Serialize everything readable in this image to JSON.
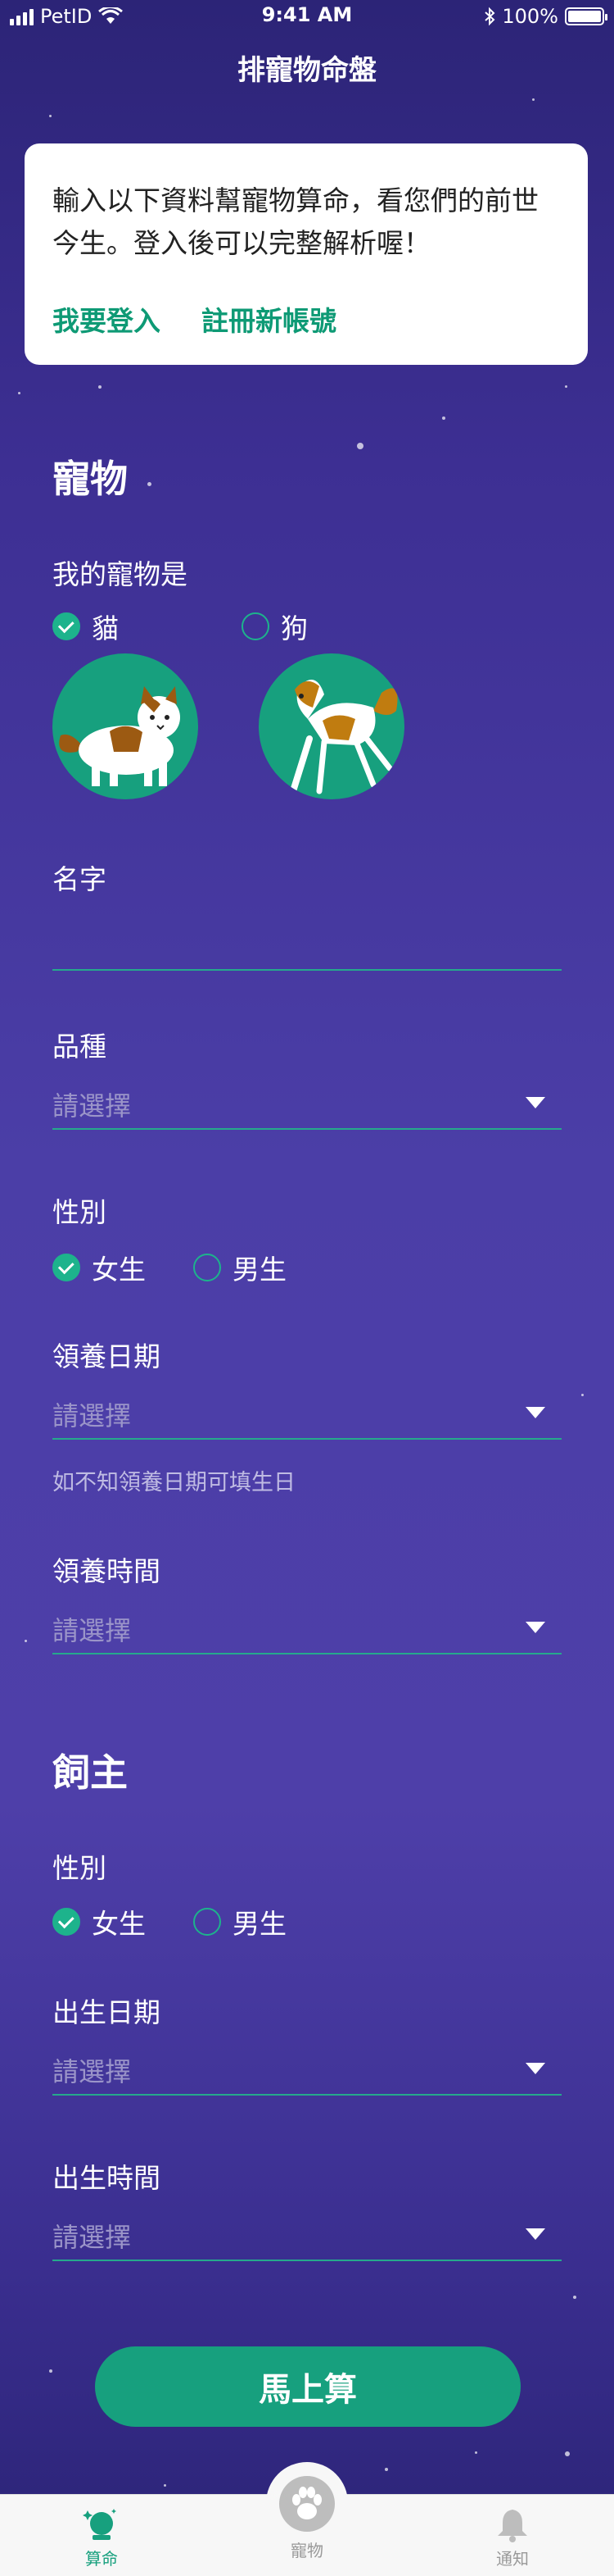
{
  "status_bar": {
    "carrier": "PetID",
    "time": "9:41 AM",
    "battery": "100%"
  },
  "nav": {
    "title": "排寵物命盤"
  },
  "login_card": {
    "message": "輸入以下資料幫寵物算命，看您們的前世今生。登入後可以完整解析喔！",
    "login_link": "我要登入",
    "register_link": "註冊新帳號"
  },
  "pet_section": {
    "title": "寵物",
    "type_label": "我的寵物是",
    "type_options": [
      {
        "label": "貓",
        "checked": true
      },
      {
        "label": "狗",
        "checked": false
      }
    ],
    "name_label": "名字",
    "name_value": "",
    "breed_label": "品種",
    "breed_placeholder": "請選擇",
    "gender_label": "性別",
    "gender_options": [
      {
        "label": "女生",
        "checked": true
      },
      {
        "label": "男生",
        "checked": false
      }
    ],
    "adopt_date_label": "領養日期",
    "adopt_date_placeholder": "請選擇",
    "adopt_date_hint": "如不知領養日期可填生日",
    "adopt_time_label": "領養時間",
    "adopt_time_placeholder": "請選擇"
  },
  "owner_section": {
    "title": "飼主",
    "gender_label": "性別",
    "gender_options": [
      {
        "label": "女生",
        "checked": true
      },
      {
        "label": "男生",
        "checked": false
      }
    ],
    "birth_date_label": "出生日期",
    "birth_date_placeholder": "請選擇",
    "birth_time_label": "出生時間",
    "birth_time_placeholder": "請選擇"
  },
  "submit_label": "馬上算",
  "tabbar": {
    "items": [
      {
        "label": "算命",
        "icon": "fortune-crystal-icon",
        "active": true
      },
      {
        "label": "寵物",
        "icon": "paw-icon",
        "active": false
      },
      {
        "label": "通知",
        "icon": "bell-icon",
        "active": false
      }
    ]
  },
  "colors": {
    "accent": "#17a07e",
    "background_top": "#2c2477",
    "background_mid": "#4b3ea7",
    "card": "#ffffff"
  }
}
